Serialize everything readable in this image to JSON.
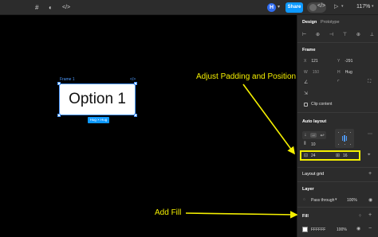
{
  "toolbar": {
    "frame_icon": "#",
    "theme_icon": "◐",
    "code_icon": "</>",
    "avatar_initial": "H",
    "avatar_caret": "▾",
    "share_label": "Share",
    "dev_mode_icon": "</>",
    "play_icon": "▷",
    "play_caret": "▾",
    "zoom_level": "117%",
    "zoom_caret": "▾"
  },
  "canvas": {
    "frame_label": "Frame 1",
    "frame_code_icon": "</>",
    "frame_text": "Option 1",
    "size_badge": "Hug × Hug",
    "annotation_padding": "Adjust Padding and Position",
    "annotation_fill": "Add Fill"
  },
  "panel": {
    "tabs": [
      "Design",
      "Prototype"
    ],
    "align_icons": [
      "⊢",
      "⊕",
      "⊣",
      "⊤",
      "⊕",
      "⊥"
    ],
    "frame": {
      "title": "Frame",
      "x_label": "X",
      "x_value": "121",
      "y_label": "Y",
      "y_value": "-291",
      "w_label": "W",
      "w_value": "150",
      "h_label": "H",
      "h_value": "Hug",
      "clip_label": "Clip content"
    },
    "auto_layout": {
      "title": "Auto layout",
      "direction_icons": [
        "↓",
        "→",
        "↩"
      ],
      "gap_value": "10",
      "horizontal_padding": "24",
      "vertical_padding": "16",
      "more_icon": "⋯"
    },
    "layout_grid": {
      "title": "Layout grid",
      "add": "+"
    },
    "layer": {
      "title": "Layer",
      "blend_mode": "Pass through",
      "opacity": "100%",
      "eye": "◉"
    },
    "fill": {
      "title": "Fill",
      "hex": "FFFFFF",
      "opacity": "100%",
      "grid_icon": "⁘",
      "add": "+",
      "eye": "◉",
      "remove": "−",
      "swatch_color": "#FFFFFF"
    }
  }
}
